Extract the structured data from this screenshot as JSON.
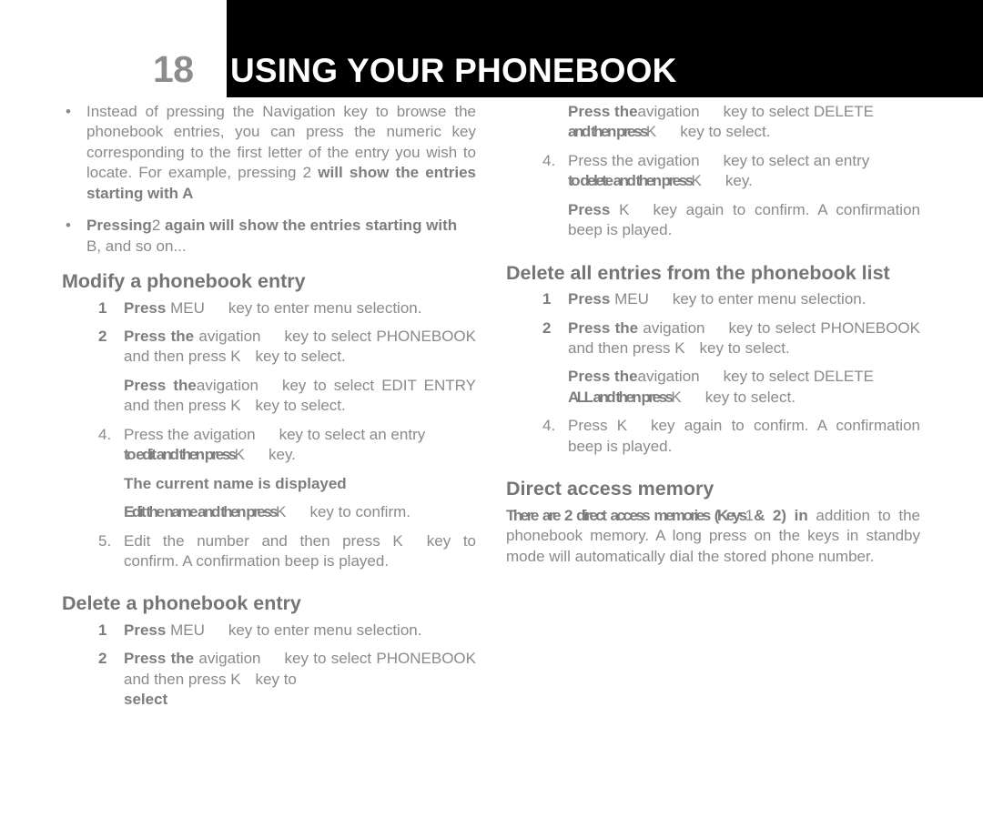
{
  "header": {
    "chapter_number": "18",
    "title": "USING YOUR PHONEBOOK"
  },
  "left_column": {
    "bullets": [
      {
        "normal_1": "Instead of pressing the Navigation key to browse the phonebook entries, you can press the numeric key corresponding to the first letter of the entry you wish to locate. For example, pressing 2 ",
        "bold_1": "will show the entries starting with A"
      },
      {
        "bold_1": "Pressing",
        "normal_inline": "2",
        "bold_2": " again will show the entries starting with",
        "normal_2": "B, and so on..."
      }
    ],
    "sections": [
      {
        "heading": "Modify a phonebook entry",
        "steps": [
          {
            "num": "1",
            "bold_1": "Press",
            "normal_1": "MEU",
            "normal_2": "key to enter menu selection."
          },
          {
            "num": "2",
            "bold_1": "Press the",
            "normal_1": "avigation",
            "normal_2": "key to select PHONEBOOK and then press K",
            "normal_3": "key to select."
          }
        ],
        "substeps": [
          {
            "bold_1": "Press the",
            "normal_1": "avigation",
            "normal_2": "key to select EDIT ENTRY and then press K",
            "normal_3": "key to select."
          }
        ],
        "steps_2": [
          {
            "num": "4.",
            "normal_1": "Press the avigation",
            "normal_2": "key to select an entry",
            "bold_1": "to edit and then press",
            "bold_2": "K",
            "normal_3": "key."
          }
        ],
        "substeps_2": [
          {
            "bold_1": "The current name is displayed"
          },
          {
            "bold_1": "Edit the name and then press",
            "bold_2": "K",
            "normal_1": "key to confirm."
          }
        ],
        "steps_3": [
          {
            "num": "5.",
            "normal_1": "Edit the number and then press K",
            "normal_2": "key to confirm. A confirmation beep is played."
          }
        ]
      },
      {
        "heading": "Delete a phonebook entry",
        "steps": [
          {
            "num": "1",
            "bold_1": "Press",
            "normal_1": "MEU",
            "normal_2": "key to enter menu selection."
          },
          {
            "num": "2",
            "bold_1": "Press the",
            "normal_1": "avigation",
            "normal_2": "key to select PHONEBOOK and then press K",
            "normal_3": "key to",
            "bold_2": "select"
          }
        ]
      }
    ]
  },
  "right_column": {
    "continued": {
      "substep": {
        "bold_1": "Press the",
        "normal_1": "avigation",
        "normal_2": "key to select DELETE",
        "bold_2": "and then press",
        "bold_3": "K",
        "normal_3": "key to select."
      },
      "step_4": {
        "num": "4.",
        "normal_1": "Press the avigation",
        "normal_2": "key to select an entry",
        "bold_1": "to delete and then press",
        "bold_2": "K",
        "normal_3": "key."
      },
      "substep_confirm": {
        "bold_1": "Press",
        "normal_1": "K",
        "normal_2": "key again to confirm. A confirmation beep is played."
      }
    },
    "sections": [
      {
        "heading": "Delete all entries from the phonebook list",
        "steps": [
          {
            "num": "1",
            "bold_1": "Press",
            "normal_1": "MEU",
            "normal_2": "key to enter menu selection."
          },
          {
            "num": "2",
            "bold_1": "Press the",
            "normal_1": "avigation",
            "normal_2": "key to select PHONEBOOK and then press K",
            "normal_3": "key to select."
          }
        ],
        "substeps": [
          {
            "bold_1": "Press the",
            "normal_1": "avigation",
            "normal_2": "key to select DELETE",
            "bold_2": "ALL and then press",
            "bold_3": "K",
            "normal_3": "key to select."
          }
        ],
        "steps_2": [
          {
            "num": "4.",
            "normal_1": "Press K",
            "normal_2": "key again to confirm. A confirmation beep is played."
          }
        ]
      },
      {
        "heading": "Direct access memory",
        "paragraph": {
          "bold_1": "There are 2 direct access memories (Keys",
          "normal_inline": "1",
          "bold_2": "& 2) in",
          "normal_1": "addition to the phonebook memory. A long press on the keys in standby mode will automatically dial the stored phone number."
        }
      }
    ]
  }
}
